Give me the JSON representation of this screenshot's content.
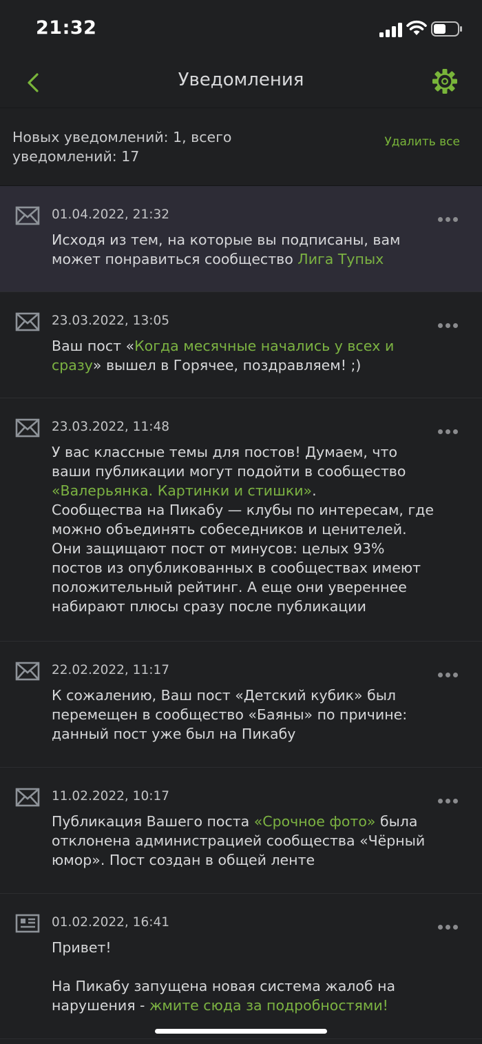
{
  "status_bar": {
    "time": "21:32"
  },
  "nav": {
    "title": "Уведомления"
  },
  "summary": {
    "line1": "Новых уведомлений: 1, всего",
    "line2": "уведомлений: 17",
    "delete_all": "Удалить все"
  },
  "colors": {
    "accent": "#79b53a",
    "background": "#1f2022",
    "unread_background": "#2d2c36"
  },
  "notifications": [
    {
      "icon": "envelope-icon",
      "date": "01.04.2022, 21:32",
      "unread": true,
      "parts": [
        {
          "text": "Исходя из тем, на которые вы подписаны, вам"
        },
        {
          "text": "может понравиться сообщество "
        },
        {
          "link": "Лига Тупых"
        }
      ]
    },
    {
      "icon": "envelope-icon",
      "date": "23.03.2022, 13:05",
      "unread": false,
      "parts": [
        {
          "text": "Ваш пост «"
        },
        {
          "link": "Когда месячные начались у всех и"
        },
        {
          "link": "сразу"
        },
        {
          "text": "» вышел в Горячее, поздравляем! ;)"
        }
      ]
    },
    {
      "icon": "envelope-icon",
      "date": "23.03.2022, 11:48",
      "unread": false,
      "parts": [
        {
          "text": "У вас классные темы для постов! Думаем, что"
        },
        {
          "text": "ваши публикации могут подойти в сообщество"
        },
        {
          "link": "«Валерьянка. Картинки и стишки»"
        },
        {
          "text": "."
        },
        {
          "text": "Сообщества на Пикабу — клубы по интересам, где"
        },
        {
          "text": "можно объединять собеседников и ценителей."
        },
        {
          "text": "Они защищают пост от минусов: целых 93%"
        },
        {
          "text": "постов из опубликованных в сообществах имеют"
        },
        {
          "text": "положительный рейтинг. А еще они увереннее"
        },
        {
          "text": "набирают плюсы сразу после публикации"
        }
      ]
    },
    {
      "icon": "envelope-icon",
      "date": "22.02.2022, 11:17",
      "unread": false,
      "parts": [
        {
          "text": "К сожалению, Ваш пост «Детский кубик» был"
        },
        {
          "text": "перемещен в сообщество «Баяны» по причине:"
        },
        {
          "text": "данный пост уже был на Пикабу"
        }
      ]
    },
    {
      "icon": "envelope-icon",
      "date": "11.02.2022, 10:17",
      "unread": false,
      "parts": [
        {
          "text": "Публикация Вашего поста "
        },
        {
          "link": "«Срочное фото»"
        },
        {
          "text": " была"
        },
        {
          "text": "отклонена администрацией сообщества «Чёрный"
        },
        {
          "text": "юмор». Пост создан в общей ленте"
        }
      ]
    },
    {
      "icon": "newspaper-icon",
      "date": "01.02.2022, 16:41",
      "unread": false,
      "parts": [
        {
          "text": "Привет!"
        },
        {
          "text": "На Пикабу запущена новая система жалоб на"
        },
        {
          "text": "нарушения - "
        },
        {
          "link": "жмите сюда за подробностями!"
        }
      ]
    }
  ]
}
